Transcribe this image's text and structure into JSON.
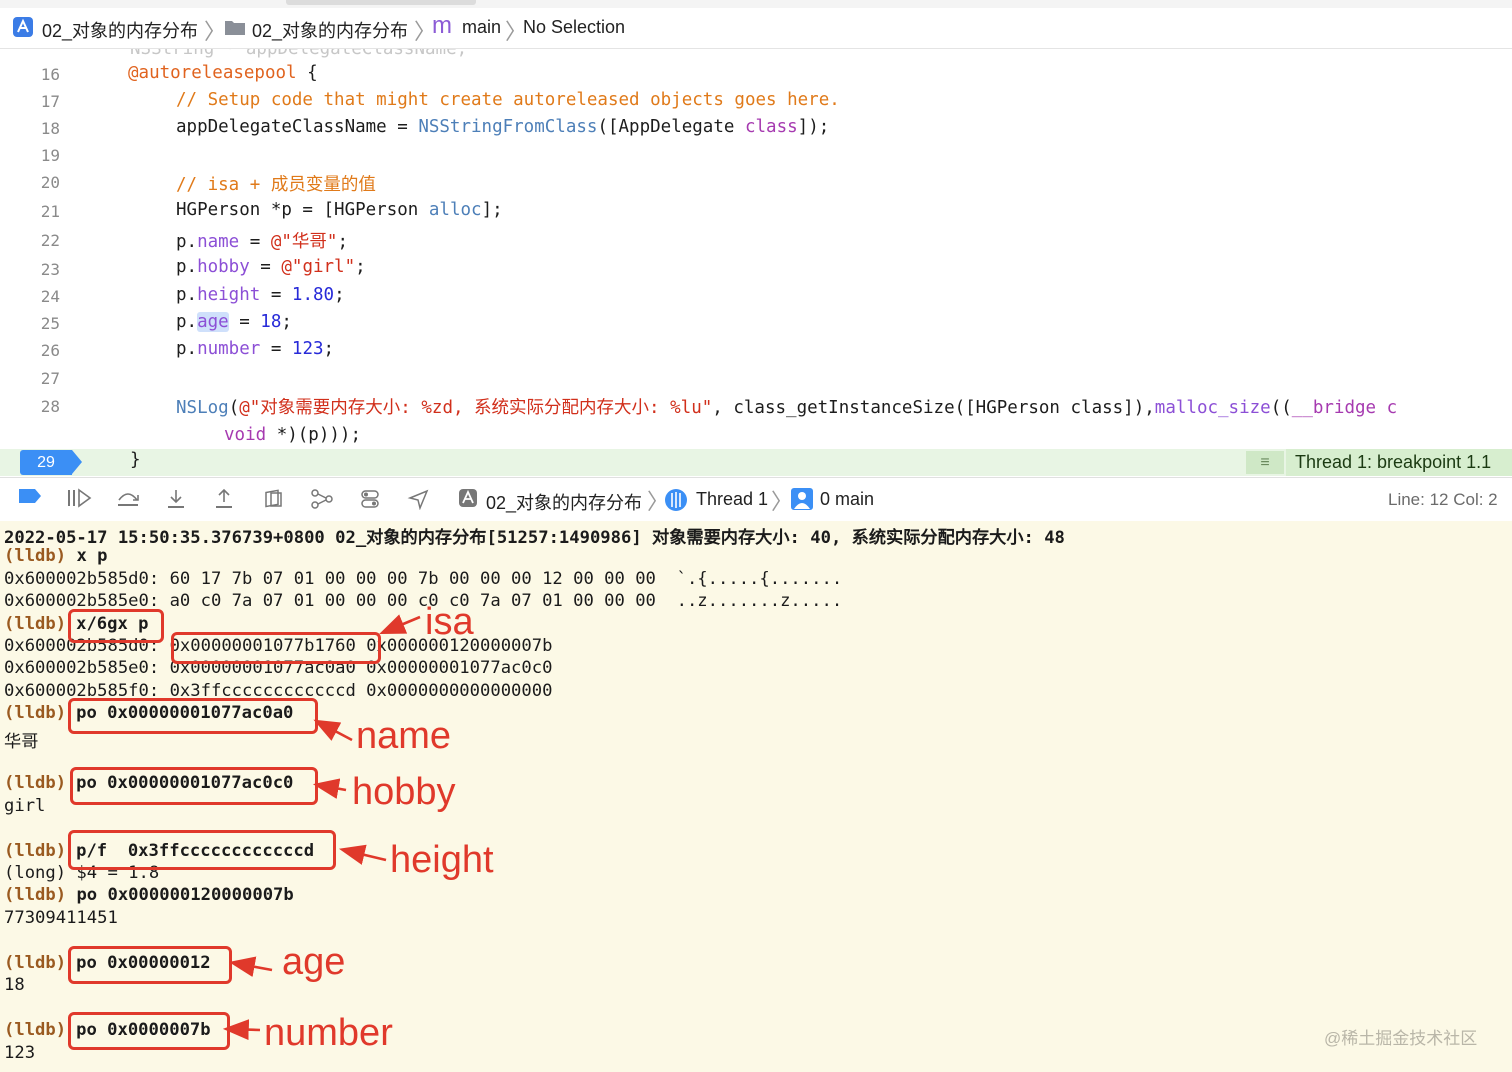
{
  "breadcrumb": {
    "project": "02_对象的内存分布",
    "folder": "02_对象的内存分布",
    "file_letter": "m",
    "file": "main",
    "symbol": "No Selection"
  },
  "editor": {
    "partial_top": "NSString * appDelegateClassName;",
    "lines": [
      {
        "n": "16"
      },
      {
        "n": "17"
      },
      {
        "n": "18"
      },
      {
        "n": "19"
      },
      {
        "n": "20"
      },
      {
        "n": "21"
      },
      {
        "n": "22"
      },
      {
        "n": "23"
      },
      {
        "n": "24"
      },
      {
        "n": "25"
      },
      {
        "n": "26"
      },
      {
        "n": "27"
      },
      {
        "n": "28"
      }
    ],
    "code": {
      "l16_attr": "@autoreleasepool",
      "l16_rest": " {",
      "l17_comment": "// Setup code that might create autoreleased objects goes here.",
      "l18_a": "appDelegateClassName = ",
      "l18_fn": "NSStringFromClass",
      "l18_b": "([AppDelegate ",
      "l18_kw": "class",
      "l18_c": "]);",
      "l20_comment": "// isa + 成员变量的值",
      "l21_a": "HGPerson *p = [HGPerson ",
      "l21_fn": "alloc",
      "l21_b": "];",
      "l22_a": "p.",
      "l22_prop": "name",
      "l22_b": " = ",
      "l22_str": "@\"华哥\"",
      "l22_c": ";",
      "l23_a": "p.",
      "l23_prop": "hobby",
      "l23_b": " = ",
      "l23_str": "@\"girl\"",
      "l23_c": ";",
      "l24_a": "p.",
      "l24_prop": "height",
      "l24_b": " = ",
      "l24_num": "1.80",
      "l24_c": ";",
      "l25_a": "p.",
      "l25_prop": "age",
      "l25_b": " = ",
      "l25_num": "18",
      "l25_c": ";",
      "l26_a": "p.",
      "l26_prop": "number",
      "l26_b": " = ",
      "l26_num": "123",
      "l26_c": ";",
      "l28_fn": "NSLog",
      "l28_a": "(",
      "l28_str": "@\"对象需要内存大小: %zd, 系统实际分配内存大小: %lu\"",
      "l28_b": ", class_getInstanceSize([HGPerson class]),",
      "l28_fn2": "malloc_size",
      "l28_c": "((",
      "l28_kw": "__bridge c",
      "l28b_kw": "void",
      "l28b_rest": " *)(p)));"
    },
    "breakpoint_line": "29",
    "breakpoint_brace": "}",
    "breakpoint_label": "Thread 1: breakpoint 1.1"
  },
  "debug_bar": {
    "scheme": "02_对象的内存分布",
    "thread": "Thread 1",
    "frame": "0 main",
    "position": "Line: 12  Col: 2"
  },
  "console": {
    "log_line": "2022-05-17 15:50:35.376739+0800 02_对象的内存分布[51257:1490986] 对象需要内存大小: 40, 系统实际分配内存大小: 48",
    "prompt": "(lldb)",
    "cmd1": " x p",
    "mem1": "0x600002b585d0: 60 17 7b 07 01 00 00 00 7b 00 00 00 12 00 00 00  `.{.....{.......",
    "mem2": "0x600002b585e0: a0 c0 7a 07 01 00 00 00 c0 c0 7a 07 01 00 00 00  ..z.......z.....",
    "cmd2": "x/6gx p",
    "gx1_addr": "0x600002b585d0: ",
    "gx1_v1": "0x00000001077b1760",
    "gx1_v2": " 0x000000120000007b",
    "gx2": "0x600002b585e0: 0x00000001077ac0a0 0x00000001077ac0c0",
    "gx3": "0x600002b585f0: 0x3ffccccccccccccd 0x0000000000000000",
    "cmd3": "po 0x00000001077ac0a0",
    "out3": "华哥",
    "cmd4": "po 0x00000001077ac0c0",
    "out4": "girl",
    "cmd5": "p/f  0x3ffccccccccccccd",
    "out5": "(long) $4 = 1.8",
    "cmd6": " po 0x000000120000007b",
    "out6": "77309411451",
    "cmd7": "po 0x00000012",
    "out7": "18",
    "cmd8": "po 0x0000007b",
    "out8": "123"
  },
  "annotations": {
    "isa": "isa",
    "name": "name",
    "hobby": "hobby",
    "height": "height",
    "age": "age",
    "number": "number",
    "color": "#e0392b"
  },
  "watermark": "@稀土掘金技术社区"
}
